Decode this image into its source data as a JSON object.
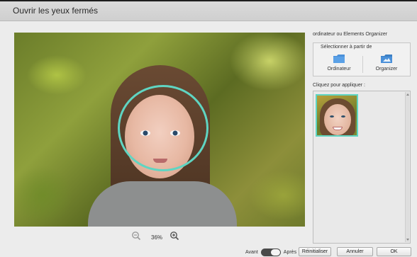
{
  "window": {
    "title": "Ouvrir les yeux fermés"
  },
  "source": {
    "heading": "ordinateur ou Elements Organizer",
    "legend": "Sélectionner à partir de",
    "computer_label": "Ordinateur",
    "organizer_label": "Organizer"
  },
  "apply": {
    "label": "Cliquez pour appliquer :"
  },
  "zoom": {
    "value": "36%"
  },
  "toggle": {
    "before_label": "Avant",
    "after_label": "Après"
  },
  "buttons": {
    "reset": "Réinitialiser",
    "cancel": "Annuler",
    "ok": "OK"
  },
  "colors": {
    "selection_ring": "#5fd5c2",
    "folder_icon": "#4a90d9"
  },
  "icons": {
    "zoom_out": "zoom-out-icon",
    "zoom_in": "zoom-in-icon",
    "computer": "folder-icon",
    "organizer": "organizer-icon"
  }
}
